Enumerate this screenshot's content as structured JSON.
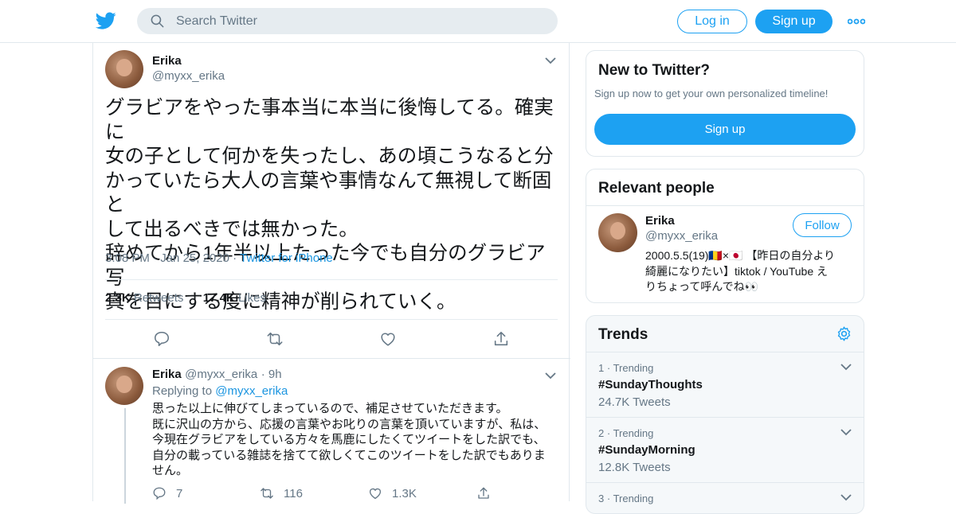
{
  "header": {
    "search_placeholder": "Search Twitter",
    "login_label": "Log in",
    "signup_label": "Sign up"
  },
  "tweet": {
    "author_name": "Erika",
    "author_handle": "@myxx_erika",
    "text_lines": [
      "グラビアをやった事本当に本当に後悔してる。確実に",
      "女の子として何かを失ったし、あの頃こうなると分",
      "かっていたら大人の言葉や事情なんて無視して断固と",
      "して出るべきでは無かった。",
      "辞めてから1年半以上たった今でも自分のグラビア写",
      "真を目にする度に精神が削られていく。"
    ],
    "time": "3:08 PM",
    "date": "Jan 25, 2020",
    "source": "Twitter for iPhone",
    "retweets_count": "2.3K",
    "retweets_label": "Retweets",
    "likes_count": "17.4K",
    "likes_label": "Likes"
  },
  "reply": {
    "author_name": "Erika",
    "author_handle": "@myxx_erika",
    "age": "9h",
    "replying_prefix": "Replying to",
    "replying_to": "@myxx_erika",
    "text_lines": [
      "思った以上に伸びてしまっているので、補足させていただきます。",
      "既に沢山の方から、応援の言葉やお叱りの言葉を頂いていますが、私は、",
      "今現在グラビアをしている方々を馬鹿にしたくてツイートをした訳でも、",
      "自分の載っている雑誌を捨てて欲しくてこのツイートをした訳でもありま",
      "せん。"
    ],
    "reply_count": "7",
    "retweet_count": "116",
    "like_count": "1.3K"
  },
  "new_to_twitter": {
    "title": "New to Twitter?",
    "subtitle": "Sign up now to get your own personalized timeline!",
    "signup_label": "Sign up"
  },
  "relevant_people": {
    "title": "Relevant people",
    "name": "Erika",
    "handle": "@myxx_erika",
    "follow_label": "Follow",
    "bio_lines": [
      "2000.5.5(19)🇷🇴×🇯🇵 【昨日の自分より",
      "綺麗になりたい】tiktok / YouTube え",
      "りちょって呼んでね👀"
    ]
  },
  "trends": {
    "title": "Trends",
    "items": [
      {
        "rank": "1",
        "label": "Trending",
        "tag": "#SundayThoughts",
        "count": "24.7K Tweets"
      },
      {
        "rank": "2",
        "label": "Trending",
        "tag": "#SundayMorning",
        "count": "12.8K Tweets"
      },
      {
        "rank": "3",
        "label": "Trending"
      }
    ]
  },
  "colors": {
    "accent": "#1da1f2",
    "link": "#1b95e0",
    "text": "#14171a",
    "muted": "#657786",
    "border": "#e1e8ed"
  },
  "icons": [
    "twitter-bird-icon",
    "search-icon",
    "more-dots-icon",
    "chevron-down-icon",
    "reply-icon",
    "retweet-icon",
    "like-icon",
    "share-icon",
    "settings-gear-icon"
  ]
}
